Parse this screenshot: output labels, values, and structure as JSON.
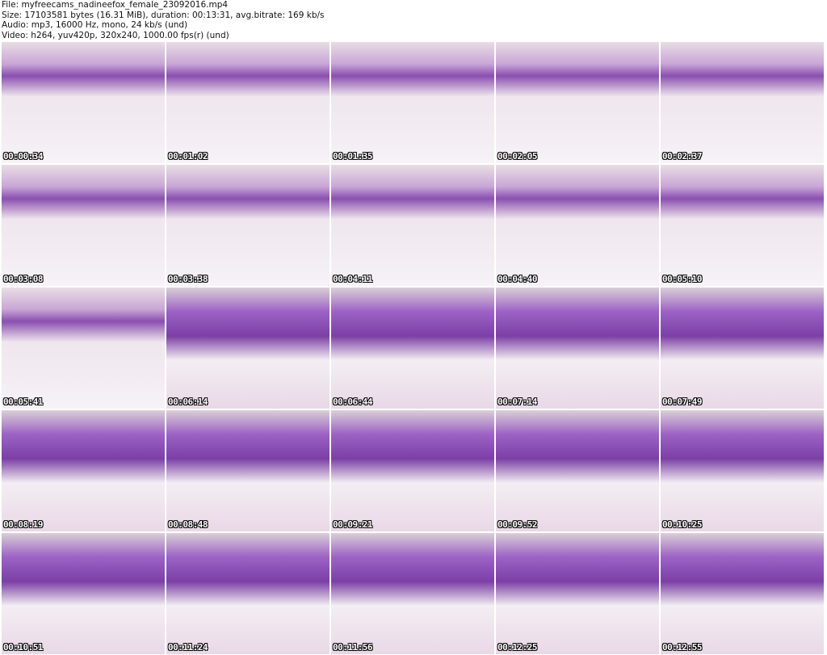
{
  "header": {
    "file": "File: myfreecams_nadineefox_female_23092016.mp4",
    "size": "Size: 17103581 bytes (16.31 MiB), duration: 00:13:31, avg.bitrate: 169 kb/s",
    "audio": "Audio: mp3, 16000 Hz, mono, 24 kb/s (und)",
    "video": "Video: h264, yuv420p, 320x240, 1000.00 fps(r) (und)"
  },
  "thumbnails": [
    "00:00:34",
    "00:01:02",
    "00:01:35",
    "00:02:05",
    "00:02:37",
    "00:03:08",
    "00:03:38",
    "00:04:11",
    "00:04:40",
    "00:05:10",
    "00:05:41",
    "00:06:14",
    "00:06:44",
    "00:07:14",
    "00:07:49",
    "00:08:19",
    "00:08:48",
    "00:09:21",
    "00:09:52",
    "00:10:25",
    "00:10:51",
    "00:11:24",
    "00:11:56",
    "00:12:25",
    "00:12:55"
  ]
}
